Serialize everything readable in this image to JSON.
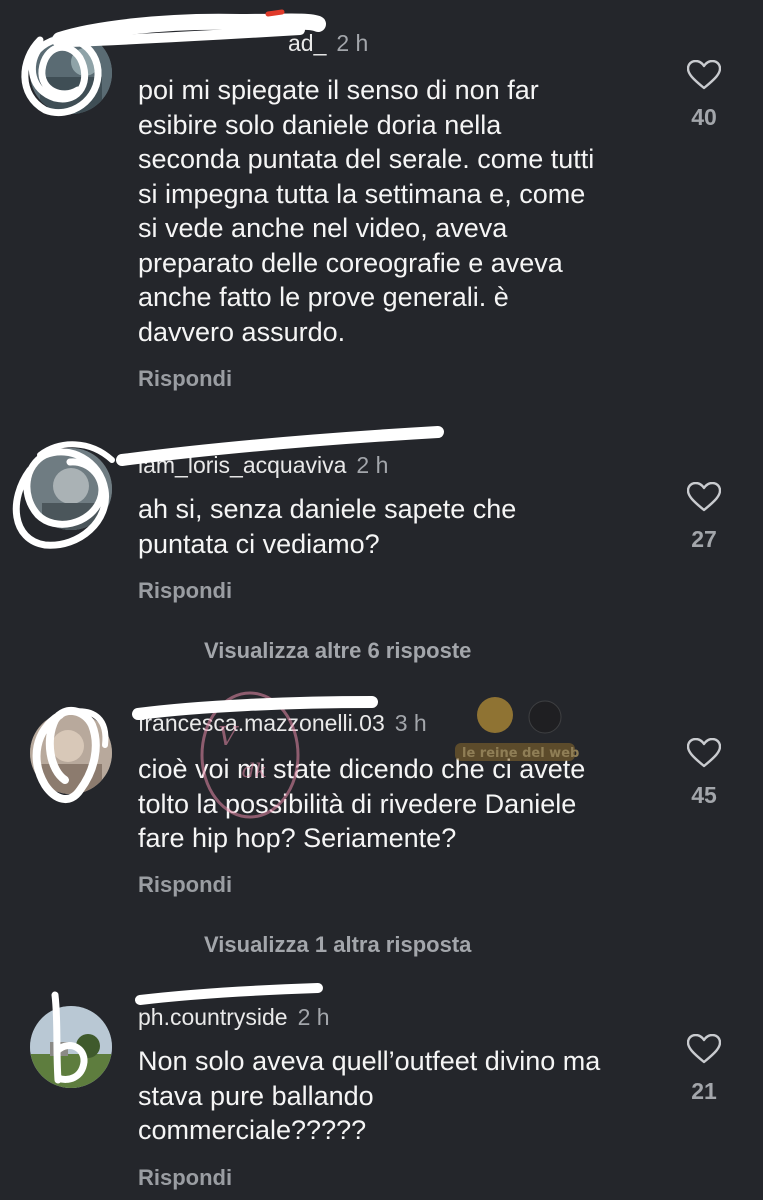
{
  "comments": [
    {
      "username": "",
      "time": "2 h",
      "text_lines": [
        "poi mi spiegate il senso di non far",
        "esibire solo daniele doria nella",
        "seconda puntata del serale. come tutti",
        "si impegna tutta la settimana e, come",
        "si vede anche nel video, aveva",
        "preparato delle coreografie e aveva",
        "anche fatto le prove generali. è",
        "davvero assurdo."
      ],
      "likes": "40",
      "reply_label": "Rispondi",
      "username_tail": "ad_"
    },
    {
      "username": "lam_loris_acquaviva",
      "time": "2 h",
      "text_lines": [
        "ah si, senza daniele sapete che",
        "puntata ci vediamo?"
      ],
      "likes": "27",
      "reply_label": "Rispondi",
      "more_replies": "Visualizza altre 6 risposte"
    },
    {
      "username": "francesca.mazzonelli.03",
      "time": "3 h",
      "text_lines": [
        "cioè voi mi state dicendo che ci avete",
        "tolto la possibilità di rivedere Daniele",
        "fare hip hop? Seriamente?"
      ],
      "likes": "45",
      "reply_label": "Rispondi",
      "more_replies": "Visualizza 1 altra risposta"
    },
    {
      "username": "ph.countryside",
      "time": "2 h",
      "text_lines": [
        "Non solo aveva quell’outfeet divino ma",
        "stava pure ballando",
        "commerciale?????"
      ],
      "likes": "21",
      "reply_label": "Rispondi"
    }
  ],
  "watermark_text": "le reine del web",
  "colors": {
    "background": "#24262b",
    "text": "#f5f5f5",
    "muted": "#a3a6ab",
    "scribble": "#ffffff",
    "red_mark": "#e03a2a"
  }
}
